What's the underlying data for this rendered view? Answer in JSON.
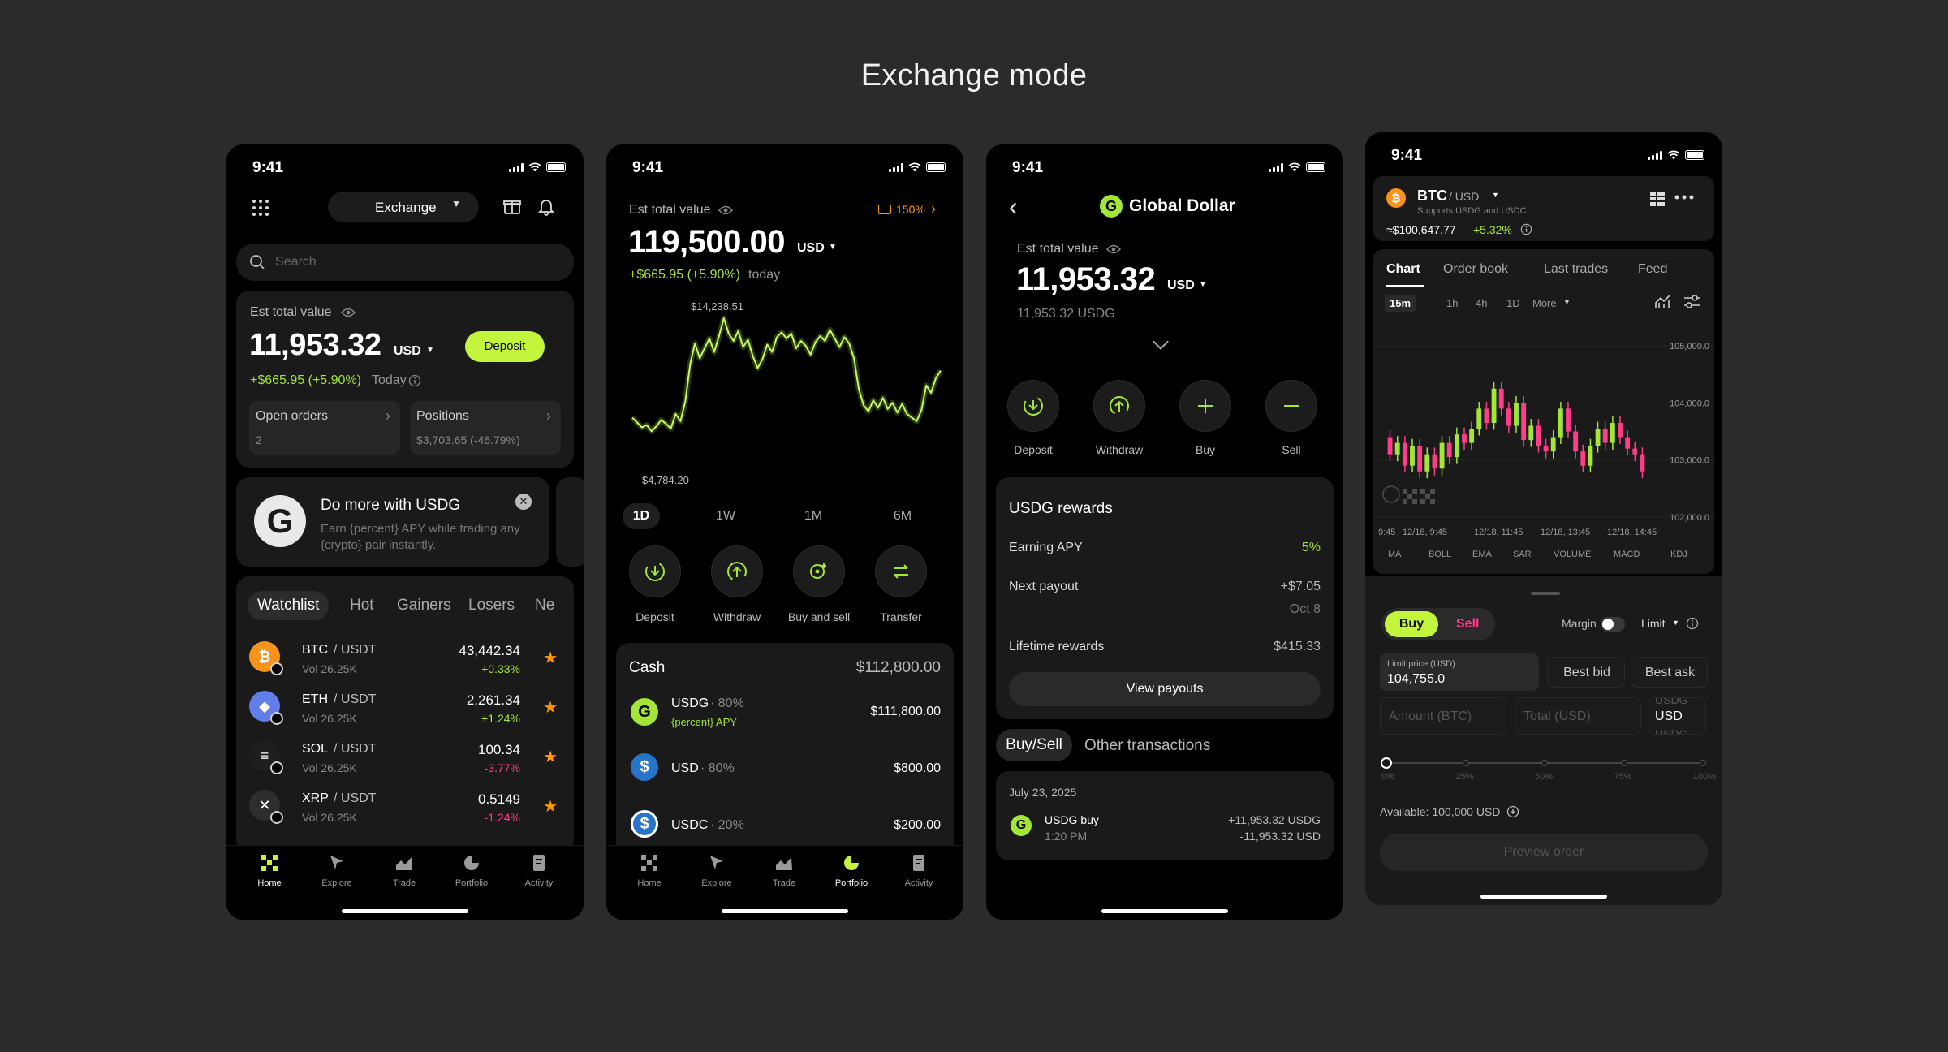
{
  "page": {
    "title": "Exchange mode"
  },
  "status": {
    "time": "9:41"
  },
  "colors": {
    "accent": "#c3f53c",
    "positive": "#a3e635",
    "negative": "#ff3d8b",
    "background": "#2b2b2b",
    "phone": "#000000",
    "card": "#1a1a1a",
    "btc": "#f7931a",
    "eth": "#627eea",
    "usd": "#2775ca"
  },
  "home": {
    "header": {
      "mode_label": "Exchange"
    },
    "search": {
      "placeholder": "Search"
    },
    "balance": {
      "label": "Est total value",
      "amount": "11,953.32",
      "currency": "USD",
      "change": "+$665.95 (+5.90%)",
      "change_suffix": "Today",
      "deposit_label": "Deposit"
    },
    "open_orders": {
      "label": "Open orders",
      "value": "2"
    },
    "positions": {
      "label": "Positions",
      "value": "$3,703.65 (-46.79%)"
    },
    "promo": {
      "title": "Do more with USDG",
      "text": "Earn {percent} APY while trading any {crypto} pair instantly."
    },
    "watch_tabs": [
      "Watchlist",
      "Hot",
      "Gainers",
      "Losers",
      "Ne"
    ],
    "watchlist": [
      {
        "base": "BTC",
        "quote": "/ USDT",
        "vol": "Vol 26.25K",
        "price": "43,442.34",
        "change": "+0.33%",
        "dir": "up",
        "icon": "bitcoin-icon",
        "glyph": "₿",
        "color": "#f7931a"
      },
      {
        "base": "ETH",
        "quote": "/ USDT",
        "vol": "Vol 26.25K",
        "price": "2,261.34",
        "change": "+1.24%",
        "dir": "up",
        "icon": "ethereum-icon",
        "glyph": "◆",
        "color": "#627eea"
      },
      {
        "base": "SOL",
        "quote": "/ USDT",
        "vol": "Vol 26.25K",
        "price": "100.34",
        "change": "-3.77%",
        "dir": "down",
        "icon": "solana-icon",
        "glyph": "≡",
        "color": "#1e1e1e"
      },
      {
        "base": "XRP",
        "quote": "/ USDT",
        "vol": "Vol 26.25K",
        "price": "0.5149",
        "change": "-1.24%",
        "dir": "down",
        "icon": "xrp-icon",
        "glyph": "✕",
        "color": "#2e2e2e"
      }
    ]
  },
  "tabbar": [
    "Home",
    "Explore",
    "Trade",
    "Portfolio",
    "Activity"
  ],
  "portfolio": {
    "balance": {
      "label": "Est total value",
      "badge": "150%",
      "amount": "119,500.00",
      "currency": "USD",
      "change": "+$665.95 (+5.90%)",
      "change_suffix": "today"
    },
    "chart_data": {
      "type": "line",
      "title": "",
      "max_label": "$14,238.51",
      "min_label": "$4,784.20",
      "ylim": [
        4784.2,
        14238.51
      ],
      "values": [
        6200,
        5800,
        5400,
        5600,
        5100,
        5500,
        6000,
        5700,
        5300,
        6500,
        5900,
        7500,
        10500,
        12200,
        11000,
        11800,
        12600,
        11500,
        12800,
        14238.51,
        13000,
        12400,
        13200,
        11900,
        12500,
        11200,
        10200,
        10900,
        12100,
        11500,
        12700,
        13100,
        12600,
        13000,
        11800,
        12400,
        12000,
        11300,
        12300,
        12800,
        12400,
        13300,
        12600,
        11900,
        12700,
        12200,
        11000,
        8500,
        7200,
        6700,
        7600,
        7000,
        7800,
        6900,
        7400,
        6600,
        7300,
        6500,
        6200,
        5900,
        6800,
        8800,
        8200,
        9400,
        10000
      ]
    },
    "ranges": [
      "1D",
      "1W",
      "1M",
      "6M"
    ],
    "actions": [
      {
        "label": "Deposit",
        "icon": "deposit-icon"
      },
      {
        "label": "Withdraw",
        "icon": "withdraw-icon"
      },
      {
        "label": "Buy and sell",
        "icon": "buy-sell-icon"
      },
      {
        "label": "Transfer",
        "icon": "transfer-icon"
      }
    ],
    "cash": {
      "title": "Cash",
      "total": "$112,800.00",
      "items": [
        {
          "name": "USDG",
          "share": " · 80%",
          "sub": "{percent} APY",
          "value": "$111,800.00",
          "icon": "usdg-icon"
        },
        {
          "name": "USD",
          "share": " · 80%",
          "sub": "",
          "value": "$800.00",
          "icon": "usd-icon"
        },
        {
          "name": "USDC",
          "share": " · 20%",
          "sub": "",
          "value": "$200.00",
          "icon": "usdc-icon"
        }
      ]
    }
  },
  "usdg": {
    "title": "Global Dollar",
    "balance": {
      "label": "Est total value",
      "amount": "11,953.32",
      "currency": "USD",
      "sub": "11,953.32 USDG"
    },
    "actions": [
      {
        "label": "Deposit",
        "icon": "deposit-icon"
      },
      {
        "label": "Withdraw",
        "icon": "withdraw-icon"
      },
      {
        "label": "Buy",
        "icon": "plus-icon"
      },
      {
        "label": "Sell",
        "icon": "minus-icon"
      }
    ],
    "rewards": {
      "title": "USDG rewards",
      "apy_label": "Earning APY",
      "apy_value": "5%",
      "payout_label": "Next payout",
      "payout_value": "+$7.05",
      "payout_date": "Oct 8",
      "lifetime_label": "Lifetime rewards",
      "lifetime_value": "$415.33",
      "view_label": "View payouts"
    },
    "tx_tabs": [
      "Buy/Sell",
      "Other transactions"
    ],
    "tx": {
      "date": "July 23, 2025",
      "title": "USDG buy",
      "time": "1:20 PM",
      "amount1": "+11,953.32 USDG",
      "amount2": "-11,953.32 USD"
    }
  },
  "trade": {
    "pair": "BTC",
    "quote": "/ USD",
    "supports": "Supports USDG and USDC",
    "price": "≈$100,647.77",
    "change": "+5.32%",
    "tabs": [
      "Chart",
      "Order book",
      "Last trades",
      "Feed"
    ],
    "intervals": [
      "15m",
      "1h",
      "4h",
      "1D",
      "More"
    ],
    "chart_data": {
      "type": "candlestick",
      "y_ticks": [
        "105,000.0",
        "104,000.0",
        "103,000.0",
        "102,000.0"
      ],
      "ylim": [
        102000,
        105300
      ],
      "x_ticks": [
        "9:45",
        "12/18, 9:45",
        "12/18, 11:45",
        "12/18, 13:45",
        "12/18, 14:45"
      ],
      "candles": [
        [
          103400,
          103100
        ],
        [
          103100,
          103300
        ],
        [
          103300,
          102900
        ],
        [
          102900,
          103250
        ],
        [
          103250,
          102800
        ],
        [
          102800,
          103100
        ],
        [
          103100,
          102850
        ],
        [
          102850,
          103300
        ],
        [
          103300,
          103050
        ],
        [
          103050,
          103450
        ],
        [
          103450,
          103300
        ],
        [
          103300,
          103550
        ],
        [
          103550,
          103900
        ],
        [
          103900,
          103650
        ],
        [
          103650,
          104250
        ],
        [
          104250,
          103900
        ],
        [
          103900,
          103600
        ],
        [
          103600,
          104000
        ],
        [
          104000,
          103350
        ],
        [
          103350,
          103600
        ],
        [
          103600,
          103250
        ],
        [
          103250,
          103150
        ],
        [
          103150,
          103400
        ],
        [
          103400,
          103900
        ],
        [
          103900,
          103500
        ],
        [
          103500,
          103150
        ],
        [
          103150,
          102900
        ],
        [
          102900,
          103250
        ],
        [
          103250,
          103550
        ],
        [
          103550,
          103300
        ],
        [
          103300,
          103650
        ],
        [
          103650,
          103400
        ],
        [
          103400,
          103200
        ],
        [
          103200,
          103100
        ],
        [
          103100,
          102800
        ]
      ]
    },
    "indicators": [
      "MA",
      "BOLL",
      "EMA",
      "SAR",
      "VOLUME",
      "MACD",
      "KDJ"
    ],
    "order": {
      "buy": "Buy",
      "sell": "Sell",
      "margin": "Margin",
      "type": "Limit",
      "limit_label": "Limit price (USD)",
      "limit_value": "104,755.0",
      "best_bid": "Best bid",
      "best_ask": "Best ask",
      "amount_ph": "Amount (BTC)",
      "total_ph": "Total (USD)",
      "unit_top": "USDG",
      "unit": "USD",
      "unit_bottom": "USDC",
      "slider_marks": [
        "0%",
        "25%",
        "50%",
        "75%",
        "100%"
      ],
      "available": "Available: 100,000 USD",
      "preview": "Preview order"
    }
  }
}
